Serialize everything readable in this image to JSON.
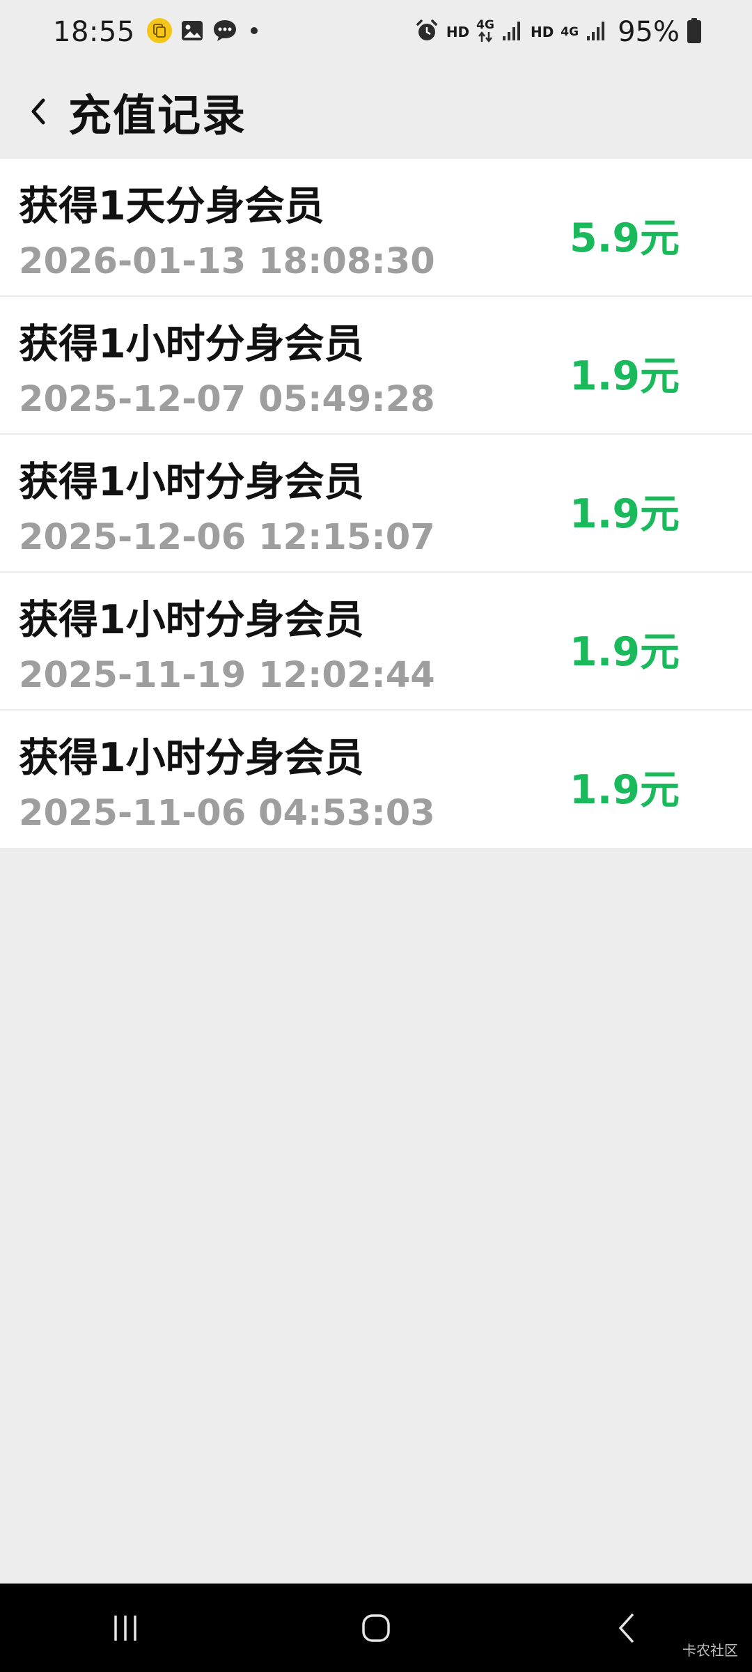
{
  "status_bar": {
    "time": "18:55",
    "battery": "95%",
    "hd_label_1": "HD",
    "hd_label_2": "HD",
    "net_label_1": "4G",
    "net_label_2": "4G",
    "icons": [
      "app-notification-icon",
      "gallery-icon",
      "message-icon",
      "dot-icon",
      "alarm-icon",
      "signal-icon",
      "battery-icon"
    ]
  },
  "header": {
    "title": "充值记录",
    "back_icon": "chevron-left-icon"
  },
  "records": [
    {
      "title": "获得1天分身会员",
      "date": "2026-01-13 18:08:30",
      "amount": "5.9元"
    },
    {
      "title": "获得1小时分身会员",
      "date": "2025-12-07 05:49:28",
      "amount": "1.9元"
    },
    {
      "title": "获得1小时分身会员",
      "date": "2025-12-06 12:15:07",
      "amount": "1.9元"
    },
    {
      "title": "获得1小时分身会员",
      "date": "2025-11-19 12:02:44",
      "amount": "1.9元"
    },
    {
      "title": "获得1小时分身会员",
      "date": "2025-11-06 04:53:03",
      "amount": "1.9元"
    }
  ],
  "nav_bar": {
    "buttons": [
      "recent-apps-icon",
      "home-icon",
      "back-icon"
    ]
  },
  "watermark": "卡农社区",
  "colors": {
    "amount": "#19b95c",
    "date": "#9e9e9e",
    "background": "#ededed"
  }
}
